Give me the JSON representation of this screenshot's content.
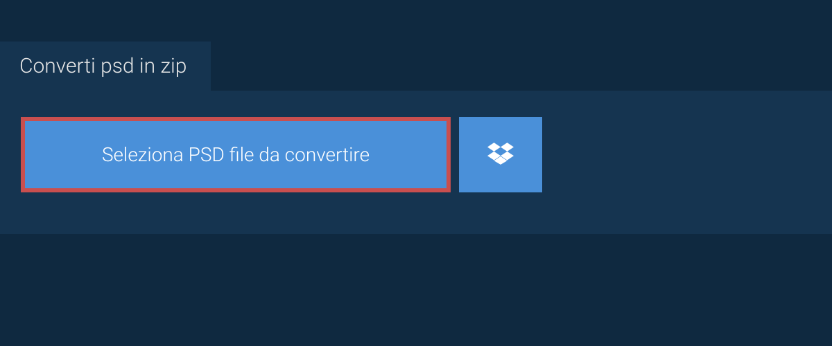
{
  "tab": {
    "title": "Converti psd in zip"
  },
  "buttons": {
    "select_file_label": "Seleziona PSD file da convertire"
  },
  "colors": {
    "background_dark": "#0f2940",
    "panel": "#153450",
    "button_blue": "#4a90d9",
    "highlight_border": "#c94f4f",
    "text_light": "#e8e8e8",
    "text_white": "#ffffff"
  }
}
